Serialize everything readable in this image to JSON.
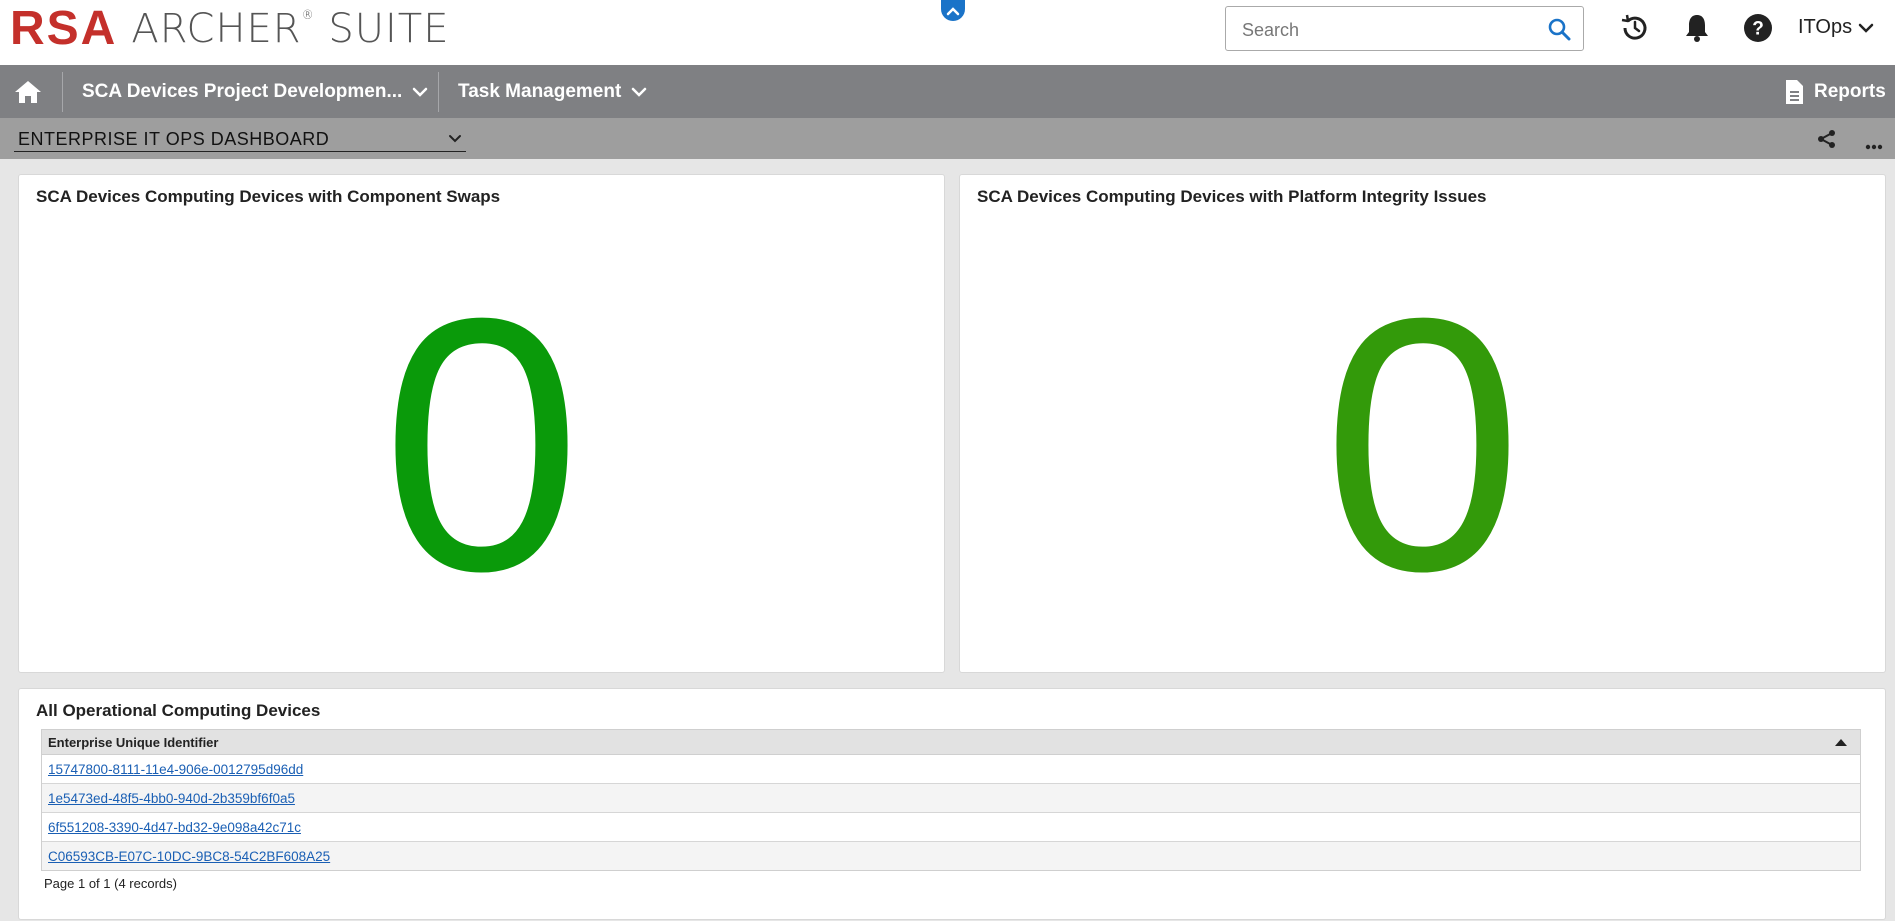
{
  "header": {
    "logo_brand": "RSA",
    "logo_product": "ARCHER",
    "logo_reg": "®",
    "logo_suite": "SUITE",
    "search_placeholder": "Search",
    "user_name": "ITOps",
    "icons": [
      "search-icon",
      "history-icon",
      "bell-icon",
      "help-icon",
      "chevron-down-icon",
      "chevron-up-icon"
    ]
  },
  "nav": {
    "home_icon": "home-icon",
    "items": [
      {
        "label": "SCA Devices Project Developmen..."
      },
      {
        "label": "Task Management"
      }
    ],
    "reports_label": "Reports"
  },
  "dashboard": {
    "selected": "ENTERPRISE IT OPS DASHBOARD",
    "icons": [
      "share-icon",
      "more-icon"
    ]
  },
  "panels": [
    {
      "title": "SCA Devices Computing Devices with Component Swaps",
      "value": "0",
      "color": "#0a9a0a"
    },
    {
      "title": "SCA Devices Computing Devices with Platform Integrity Issues",
      "value": "0",
      "color": "#339a0a"
    }
  ],
  "devices_panel": {
    "title": "All Operational Computing Devices",
    "column_header": "Enterprise Unique Identifier",
    "rows": [
      "15747800-8111-11e4-906e-0012795d96dd",
      "1e5473ed-48f5-4bb0-940d-2b359bf6f0a5",
      "6f551208-3390-4d47-bd32-9e098a42c71c",
      "C06593CB-E07C-10DC-9BC8-54C2BF608A25"
    ],
    "pager": "Page 1 of 1 (4 records)"
  },
  "colors": {
    "brand_red": "#c4302b",
    "nav_gray": "#7f8083",
    "link_blue": "#1a5fb4",
    "accent_blue": "#1a73c8"
  }
}
